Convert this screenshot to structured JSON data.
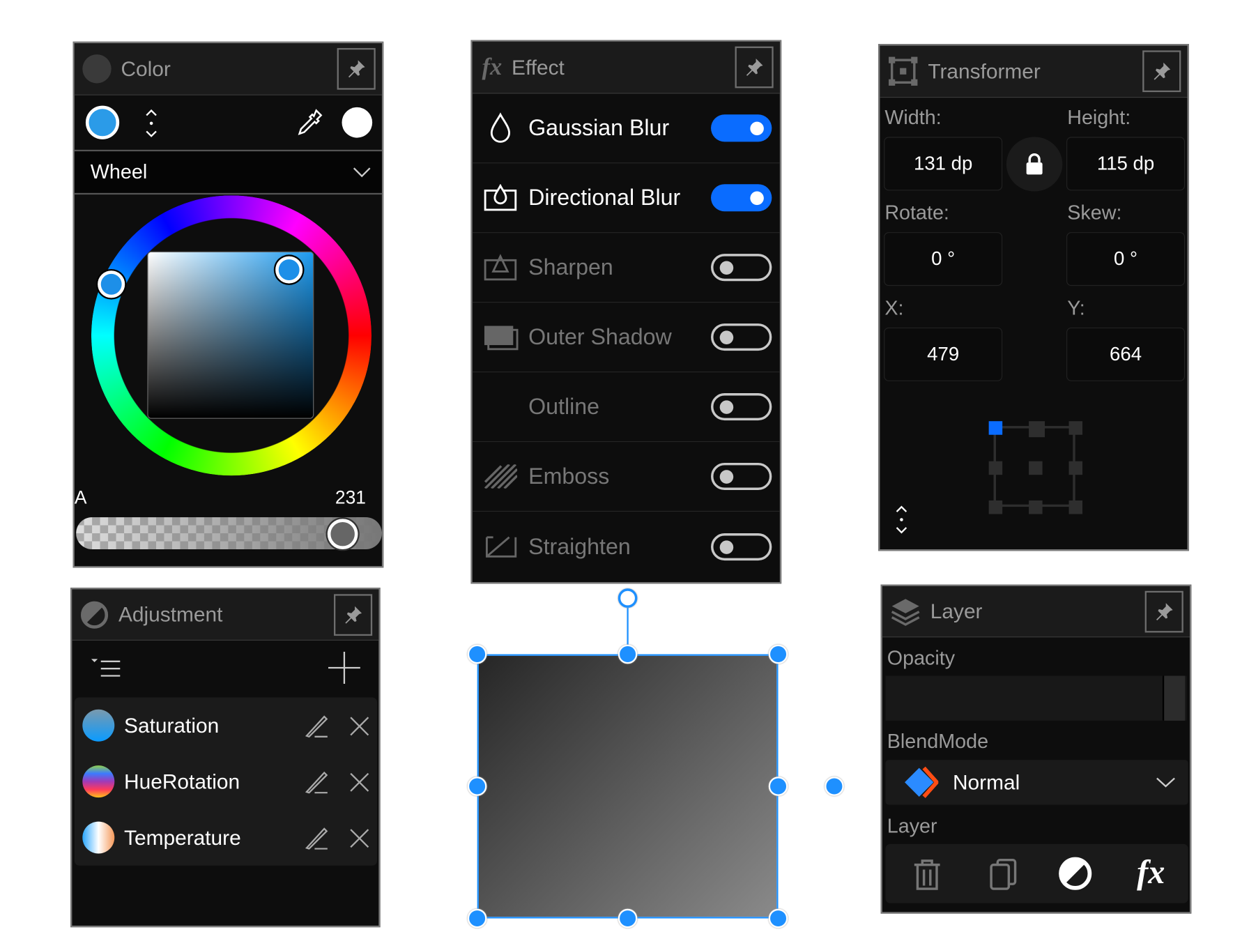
{
  "color_panel": {
    "title": "Color",
    "mode": "Wheel",
    "alpha_label": "A",
    "alpha_value": "231",
    "alpha_fraction": 0.906,
    "current_color": "#2b9be8",
    "secondary_color": "#ffffff",
    "icons": [
      "circle-icon",
      "swap-icon",
      "eyedropper-icon",
      "chevron-down-icon",
      "pin-icon"
    ]
  },
  "effect_panel": {
    "title": "Effect",
    "items": [
      {
        "label": "Gaussian Blur",
        "on": true,
        "icon": "drop-icon"
      },
      {
        "label": "Directional Blur",
        "on": true,
        "icon": "directional-blur-icon"
      },
      {
        "label": "Sharpen",
        "on": false,
        "icon": "sharpen-icon"
      },
      {
        "label": "Outer Shadow",
        "on": false,
        "icon": "shadow-icon"
      },
      {
        "label": "Outline",
        "on": false,
        "icon": ""
      },
      {
        "label": "Emboss",
        "on": false,
        "icon": "emboss-icon"
      },
      {
        "label": "Straighten",
        "on": false,
        "icon": "straighten-icon"
      }
    ],
    "accent": "#0a6cff"
  },
  "transformer_panel": {
    "title": "Transformer",
    "width_label": "Width:",
    "width": "131 dp",
    "height_label": "Height:",
    "height": "115 dp",
    "rotate_label": "Rotate:",
    "rotate": "0 °",
    "skew_label": "Skew:",
    "skew": "0 °",
    "x_label": "X:",
    "x": "479",
    "y_label": "Y:",
    "y": "664",
    "anchor": "top-left"
  },
  "adjustment_panel": {
    "title": "Adjustment",
    "items": [
      {
        "label": "Saturation"
      },
      {
        "label": "HueRotation"
      },
      {
        "label": "Temperature"
      }
    ]
  },
  "layer_panel": {
    "title": "Layer",
    "opacity_label": "Opacity",
    "opacity_fraction": 1.0,
    "blend_label": "BlendMode",
    "blend_value": "Normal",
    "layer_label": "Layer",
    "actions": [
      "trash-icon",
      "duplicate-icon",
      "adjustment-icon",
      "fx-icon"
    ]
  },
  "canvas": {
    "selection_color": "#1e90ff"
  }
}
